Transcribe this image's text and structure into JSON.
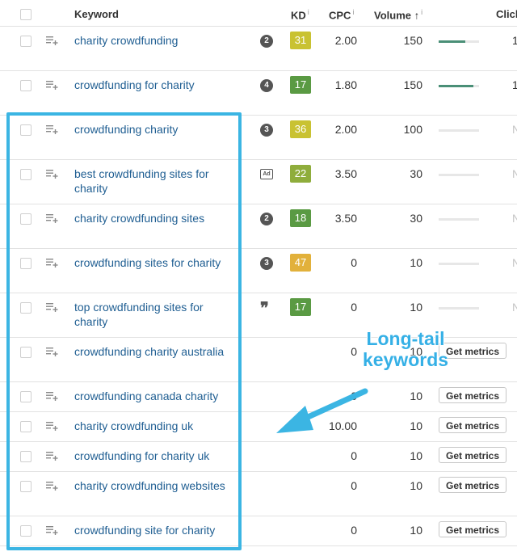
{
  "table": {
    "headers": {
      "keyword": "Keyword",
      "kd": "KD",
      "cpc": "CPC",
      "volume": "Volume",
      "sort_arrow": "↑",
      "clicks": "Clicks",
      "info_glyph": "i"
    },
    "get_metrics_label": "Get metrics",
    "rows": [
      {
        "keyword": "charity crowdfunding",
        "intent": "2",
        "kd": "31",
        "kd_color": "#c9c232",
        "cpc": "2.00",
        "volume": "150",
        "clicks_bar": 0.65,
        "clicks": "1"
      },
      {
        "keyword": "crowdfunding for charity",
        "intent": "4",
        "kd": "17",
        "kd_color": "#5a9a43",
        "cpc": "1.80",
        "volume": "150",
        "clicks_bar": 0.85,
        "clicks": "1"
      },
      {
        "keyword": "crowdfunding charity",
        "intent": "3",
        "kd": "36",
        "kd_color": "#c9c232",
        "cpc": "2.00",
        "volume": "100",
        "clicks_bar": 0,
        "clicks": "N"
      },
      {
        "keyword": "best crowdfunding sites for charity",
        "intent_icon": "ad-icon",
        "intent_text": "Ad",
        "kd": "22",
        "kd_color": "#8fad3c",
        "cpc": "3.50",
        "volume": "30",
        "clicks_bar": 0,
        "clicks": "N"
      },
      {
        "keyword": "charity crowdfunding sites",
        "intent": "2",
        "kd": "18",
        "kd_color": "#5a9a43",
        "cpc": "3.50",
        "volume": "30",
        "clicks_bar": 0,
        "clicks": "N"
      },
      {
        "keyword": "crowdfunding sites for charity",
        "intent": "3",
        "kd": "47",
        "kd_color": "#e2b13b",
        "cpc": "0",
        "volume": "10",
        "clicks_bar": 0,
        "clicks": "N"
      },
      {
        "keyword": "top crowdfunding sites for charity",
        "intent_icon": "quote-icon",
        "intent_text": "❞",
        "kd": "17",
        "kd_color": "#5a9a43",
        "cpc": "0",
        "volume": "10",
        "clicks_bar": 0,
        "clicks": "N"
      },
      {
        "keyword": "crowdfunding charity australia",
        "cpc": "0",
        "volume": "10"
      },
      {
        "keyword": "crowdfunding canada charity",
        "cpc": "0",
        "volume": "10"
      },
      {
        "keyword": "charity crowdfunding uk",
        "cpc": "10.00",
        "volume": "10"
      },
      {
        "keyword": "crowdfunding for charity uk",
        "cpc": "0",
        "volume": "10"
      },
      {
        "keyword": "charity crowdfunding websites",
        "cpc": "0",
        "volume": "10"
      },
      {
        "keyword": "crowdfunding site for charity",
        "cpc": "0",
        "volume": "10"
      }
    ]
  },
  "annotation": {
    "line1": "Long-tail",
    "line2": "keywords",
    "color": "#3bb5e3"
  }
}
